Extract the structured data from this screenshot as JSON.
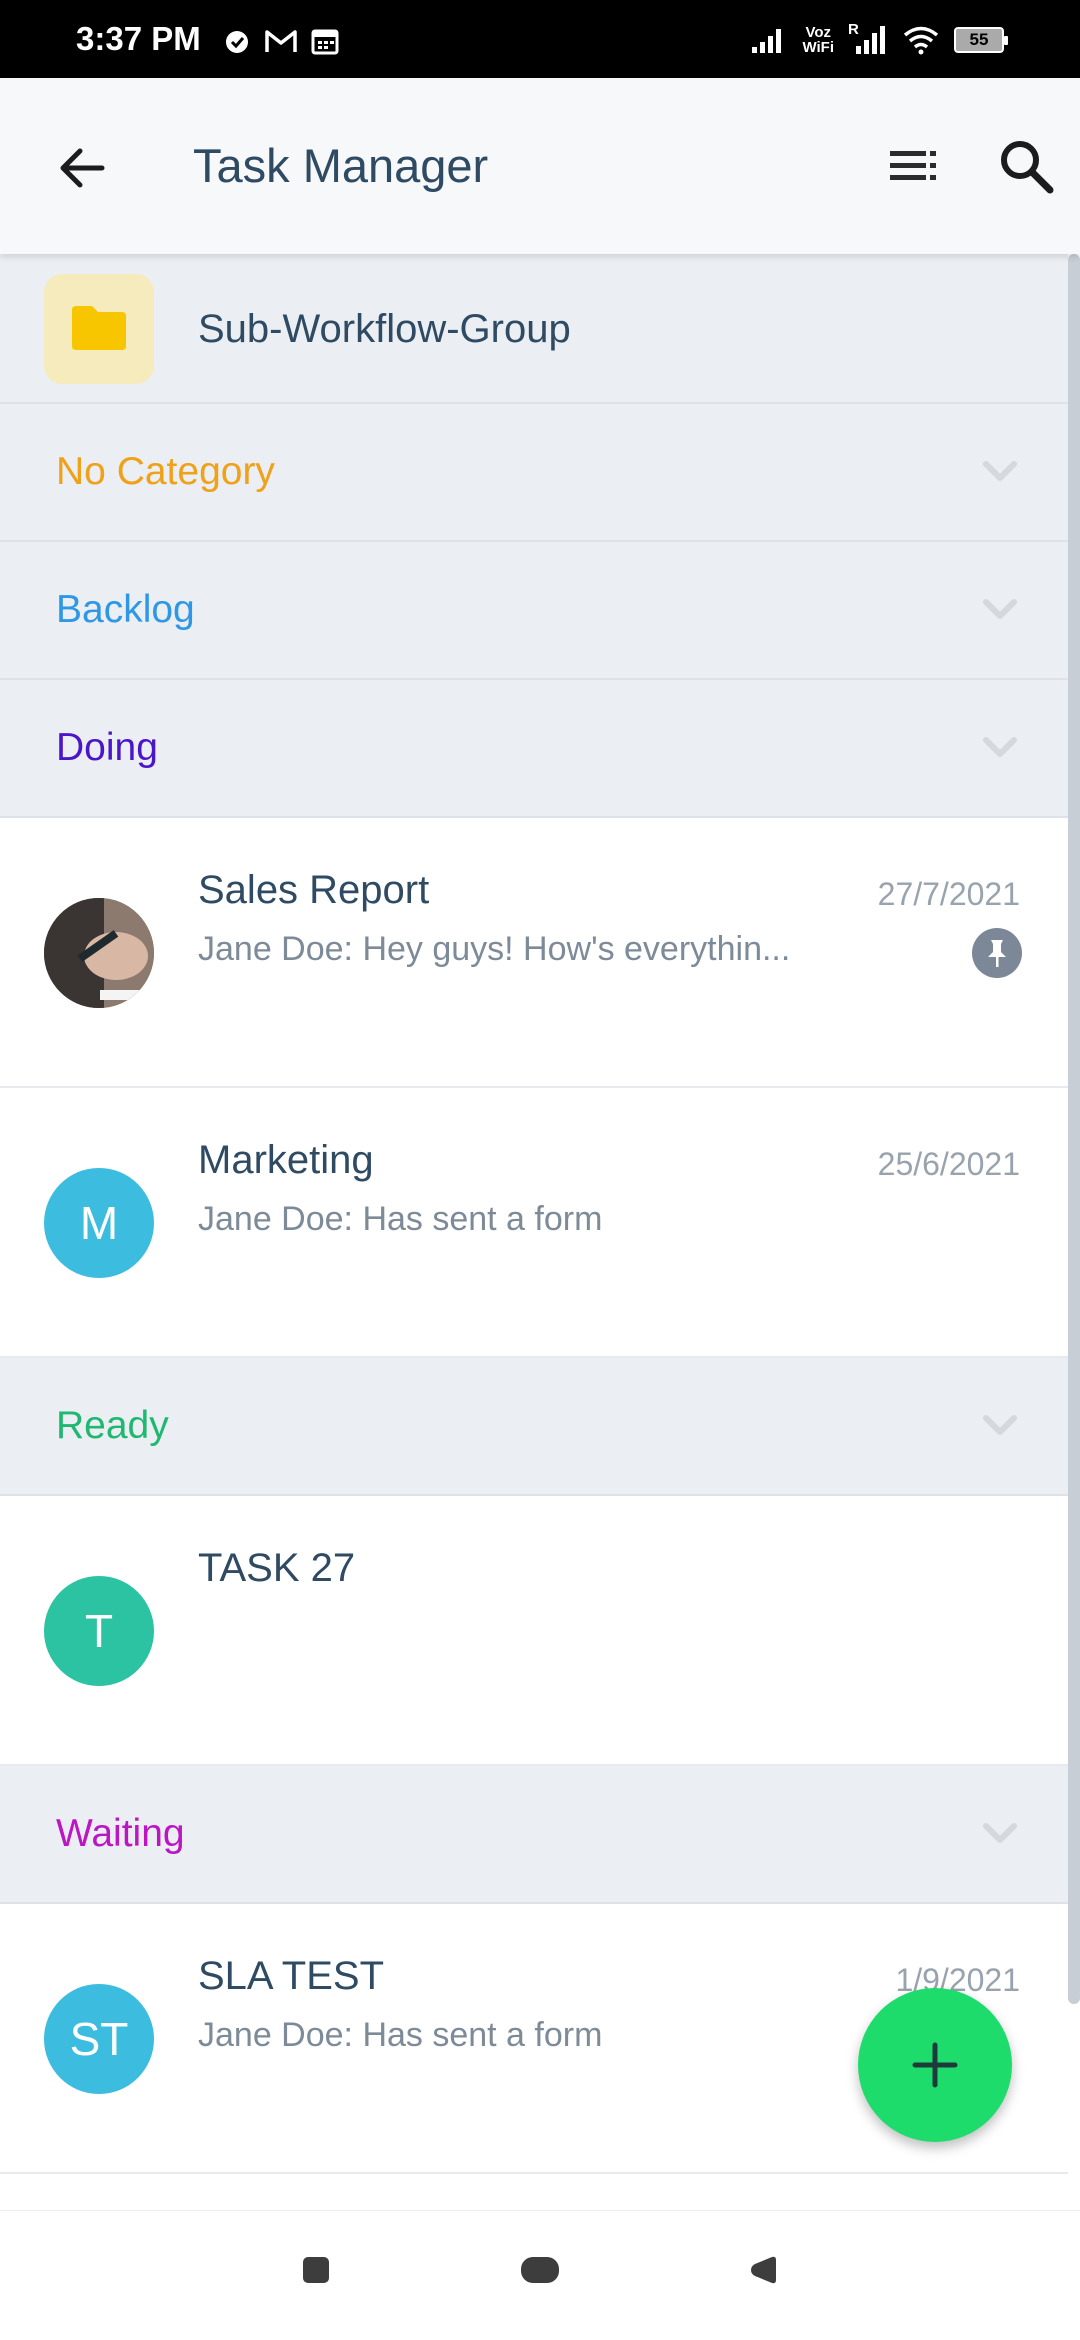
{
  "status_bar": {
    "time": "3:37 PM",
    "left_icons": [
      "alarm-icon",
      "gmail-icon",
      "calendar-icon"
    ],
    "voz_wifi_line1": "Voz",
    "voz_wifi_line2": "WiFi",
    "roaming": "R",
    "battery": "55"
  },
  "app_bar": {
    "title": "Task Manager",
    "back_icon": "arrow-left-icon",
    "menu_icon": "list-menu-icon",
    "search_icon": "search-icon"
  },
  "group": {
    "label": "Sub-Workflow-Group",
    "icon": "folder-icon"
  },
  "sections": [
    {
      "label": "No Category",
      "color": "#f0a11a"
    },
    {
      "label": "Backlog",
      "color": "#2e97e6"
    },
    {
      "label": "Doing",
      "color": "#4b16c9"
    },
    {
      "label": "Ready",
      "color": "#1fb870"
    },
    {
      "label": "Waiting",
      "color": "#bc15c4"
    }
  ],
  "tasks": [
    {
      "title": "Sales Report",
      "subtitle": "Jane Doe: Hey guys! How's everythin...",
      "date": "27/7/2021",
      "avatar": "photo",
      "pinned": true
    },
    {
      "title": "Marketing",
      "subtitle": "Jane Doe: Has sent a form",
      "date": "25/6/2021",
      "avatar": "M",
      "avatar_color": "#3cbde0"
    },
    {
      "title": "TASK 27",
      "subtitle": "",
      "date": "",
      "avatar": "T",
      "avatar_color": "#2cc3a2"
    },
    {
      "title": "SLA TEST",
      "subtitle": "Jane Doe: Has sent a form",
      "date": "1/9/2021",
      "avatar": "ST",
      "avatar_color": "#3cbde0"
    }
  ],
  "fab": {
    "icon": "plus-icon",
    "color": "#1edc6c"
  },
  "nav_bar": {
    "icons": [
      "recent-apps-icon",
      "home-icon",
      "back-nav-icon"
    ]
  }
}
